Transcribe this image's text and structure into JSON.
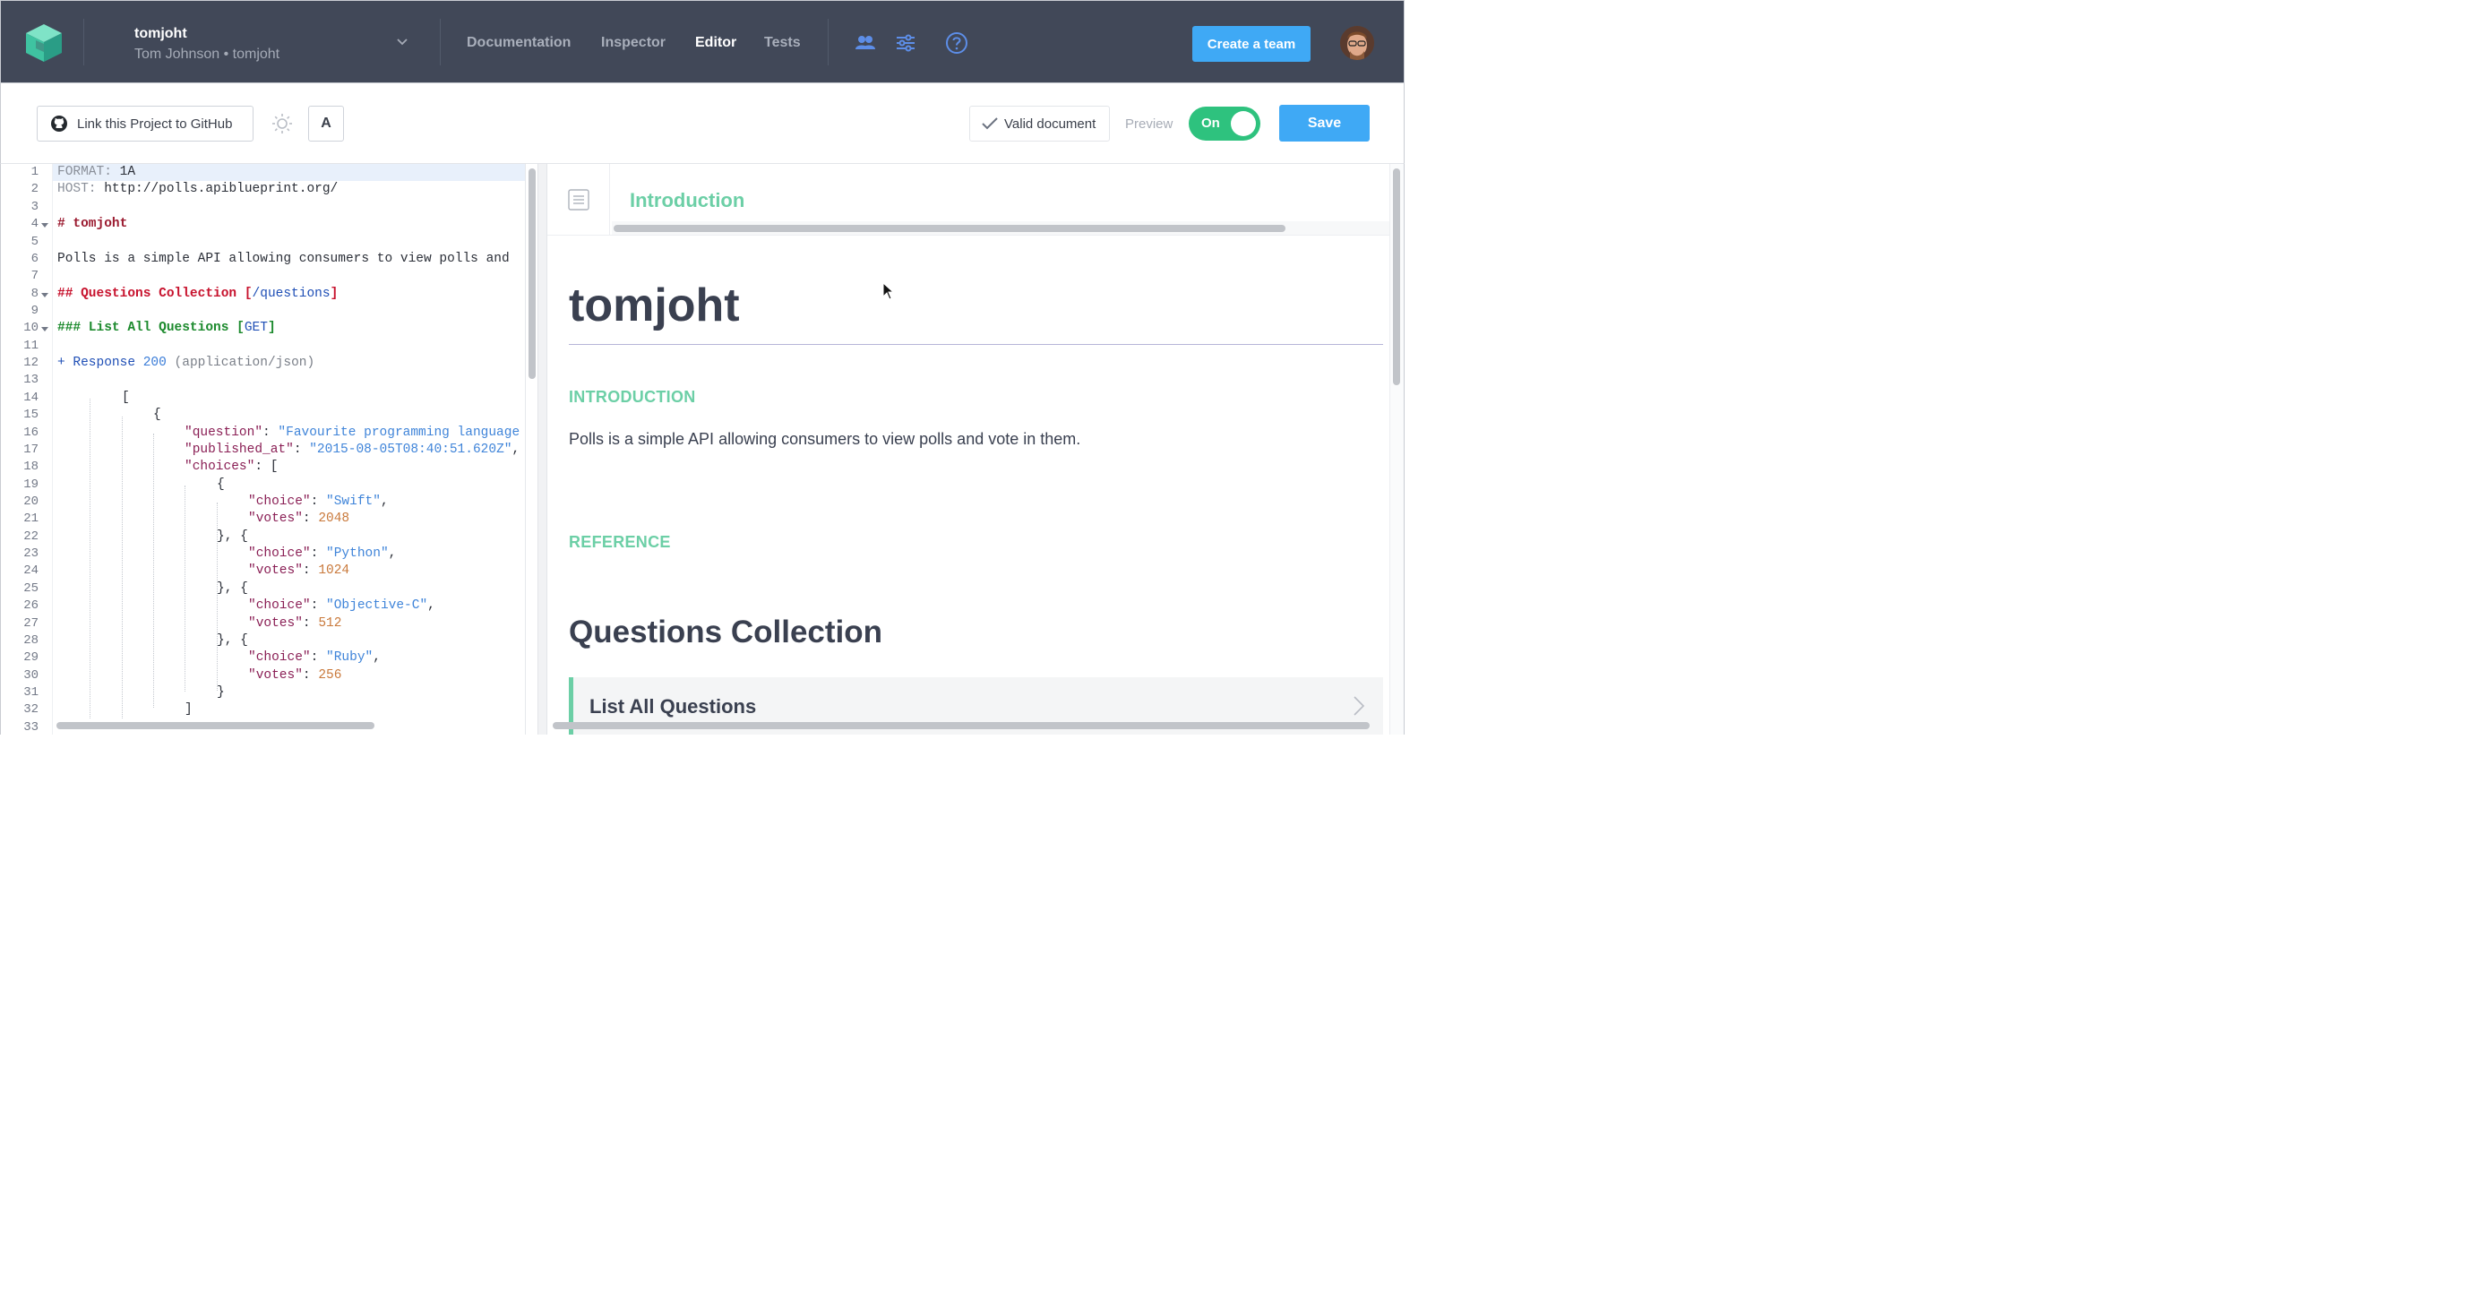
{
  "header": {
    "team_name": "tomjoht",
    "team_sub": "Tom Johnson • tomjoht",
    "nav": [
      {
        "label": "Documentation",
        "active": false
      },
      {
        "label": "Inspector",
        "active": false
      },
      {
        "label": "Editor",
        "active": true
      },
      {
        "label": "Tests",
        "active": false
      }
    ],
    "icons": [
      "team-members-icon",
      "settings-sliders-icon",
      "help-icon"
    ],
    "create_team_label": "Create a team"
  },
  "toolbar": {
    "github_label": "Link this Project to GitHub",
    "font_label": "A",
    "valid_label": "Valid document",
    "preview_label": "Preview",
    "toggle_label": "On",
    "save_label": "Save"
  },
  "editor": {
    "lines": [
      "1",
      "2",
      "3",
      "4",
      "5",
      "6",
      "7",
      "8",
      "9",
      "10",
      "11",
      "12",
      "13",
      "14",
      "15",
      "16",
      "17",
      "18",
      "19",
      "20",
      "21",
      "22",
      "23",
      "24",
      "25",
      "26",
      "27",
      "28",
      "29",
      "30",
      "31",
      "32",
      "33"
    ],
    "code": {
      "l1a": "FORMAT: ",
      "l1b": "1A",
      "l2a": "HOST: ",
      "l2b": "http://polls.apiblueprint.org/",
      "l4": "# tomjoht",
      "l6": "Polls is a simple API allowing consumers to view polls and",
      "l8a": "## Questions Collection ",
      "l8b": "[",
      "l8c": "/questions",
      "l8d": "]",
      "l10a": "### List All Questions ",
      "l10b": "[",
      "l10c": "GET",
      "l10d": "]",
      "l12a": "+ ",
      "l12b": "Response ",
      "l12c": "200",
      "l12d": " (application/json)",
      "l14": "[",
      "l15": "{",
      "l16k": "\"question\"",
      "l16v": "\"Favourite programming language",
      "l17k": "\"published_at\"",
      "l17v": "\"2015-08-05T08:40:51.620Z\"",
      "l18k": "\"choices\"",
      "l18v": "[",
      "l19": "{",
      "l20k": "\"choice\"",
      "l20v": "\"Swift\"",
      "l21k": "\"votes\"",
      "l21v": "2048",
      "l22": "}, {",
      "l23k": "\"choice\"",
      "l23v": "\"Python\"",
      "l24k": "\"votes\"",
      "l24v": "1024",
      "l25": "}, {",
      "l26k": "\"choice\"",
      "l26v": "\"Objective-C\"",
      "l27k": "\"votes\"",
      "l27v": "512",
      "l28": "}, {",
      "l29k": "\"choice\"",
      "l29v": "\"Ruby\"",
      "l30k": "\"votes\"",
      "l30v": "256",
      "l31": "}",
      "l32": "]"
    }
  },
  "preview": {
    "nav_title": "Introduction",
    "title": "tomjoht",
    "intro_heading": "INTRODUCTION",
    "intro_text": "Polls is a simple API allowing consumers to view polls and vote in them.",
    "reference_heading": "REFERENCE",
    "group_title": "Questions Collection",
    "action_title": "List All Questions"
  },
  "colors": {
    "header_bg": "#414858",
    "accent_blue": "#3fa9f5",
    "toggle_green": "#2ec27e",
    "preview_teal": "#6ccfa6"
  }
}
